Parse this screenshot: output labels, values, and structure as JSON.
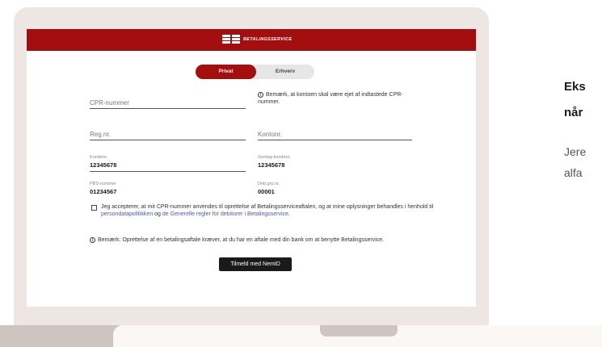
{
  "header": {
    "logo_alt": "BS",
    "logo_text": "BETALINGSSERVICE"
  },
  "toggle": {
    "privat": "Privat",
    "erhverv": "Erhverv"
  },
  "form": {
    "cpr_placeholder": "CPR-nummer",
    "cpr_note": "Bemærk, at kontoen skal være ejet af indtastede CPR-nummer.",
    "reg_placeholder": "Reg.nr.",
    "konto_placeholder": "Kontonr.",
    "kundenr_label": "Kundenr.",
    "kundenr_value": "12345678",
    "gentag_label": "Gentag kundenr.",
    "gentag_value": "12345678",
    "pbs_label": "PBS-nummer",
    "pbs_value": "01234567",
    "debgrp_label": "Deb.grp.nr.",
    "debgrp_value": "00001"
  },
  "consent": {
    "text_before": "Jeg accepterer, at mit CPR-nummer anvendes til oprettelse af Betalingsserviceaftalen, og at mine oplysninger behandles i henhold til ",
    "link1": "persondatapolitikken",
    "text_mid": " og ",
    "link2": "de Generelle regler for debitorer i Betalingsservice",
    "text_after": "."
  },
  "notice": "Bemærk: Oprettelse af en betalingsaftale kræver, at du har en aftale med din bank om at benytte Betalingsservice.",
  "submit_label": "Tilmeld med NemID",
  "side": {
    "h1": "Eks",
    "h2": "når",
    "p1": "Jere",
    "p2": "alfa"
  },
  "colors": {
    "brand": "#a30f0f",
    "link": "#4a56c8"
  }
}
